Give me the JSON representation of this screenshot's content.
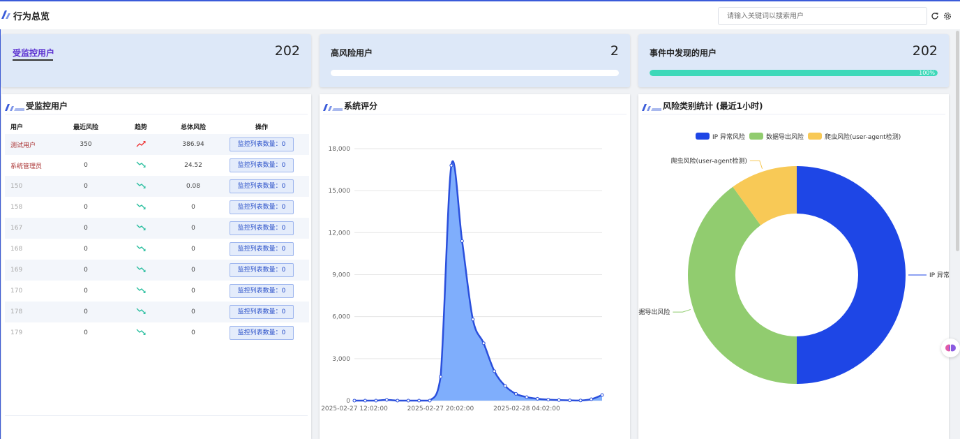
{
  "header": {
    "title": "行为总览",
    "search_placeholder": "请输入关键词以搜索用户",
    "refresh_icon": "refresh-icon",
    "settings_icon": "gear-icon"
  },
  "cards": [
    {
      "label": "受监控用户",
      "value": "202"
    },
    {
      "label": "高风险用户",
      "value": "2",
      "progress": 0
    },
    {
      "label": "事件中发现的用户",
      "value": "202",
      "progress": 100,
      "progress_text": "100%"
    }
  ],
  "users_panel": {
    "title": "受监控用户",
    "columns": [
      "用户",
      "最近风险",
      "趋势",
      "总体风险",
      "操作"
    ],
    "rows": [
      {
        "user": "测试用户",
        "recent": "350",
        "trend": "up",
        "total": "386.94",
        "action": "监控列表数量：0"
      },
      {
        "user": "系统管理员",
        "recent": "0",
        "trend": "down",
        "total": "24.52",
        "action": "监控列表数量：0"
      },
      {
        "user": "150",
        "recent": "0",
        "trend": "down",
        "total": "0.08",
        "action": "监控列表数量：0"
      },
      {
        "user": "158",
        "recent": "0",
        "trend": "down",
        "total": "0",
        "action": "监控列表数量：0"
      },
      {
        "user": "167",
        "recent": "0",
        "trend": "down",
        "total": "0",
        "action": "监控列表数量：0"
      },
      {
        "user": "168",
        "recent": "0",
        "trend": "down",
        "total": "0",
        "action": "监控列表数量：0"
      },
      {
        "user": "169",
        "recent": "0",
        "trend": "down",
        "total": "0",
        "action": "监控列表数量：0"
      },
      {
        "user": "170",
        "recent": "0",
        "trend": "down",
        "total": "0",
        "action": "监控列表数量：0"
      },
      {
        "user": "178",
        "recent": "0",
        "trend": "down",
        "total": "0",
        "action": "监控列表数量：0"
      },
      {
        "user": "179",
        "recent": "0",
        "trend": "down",
        "total": "0",
        "action": "监控列表数量：0"
      }
    ]
  },
  "score_panel": {
    "title": "系统评分"
  },
  "risk_panel": {
    "title": "风险类别统计 (最近1小时)"
  },
  "colors": {
    "accent": "#3a5bd9",
    "line": "#2a4fdc",
    "area": "#7faefc",
    "progress": "#3dd8b9"
  },
  "chart_data": [
    {
      "type": "area",
      "title": "",
      "xlabel": "",
      "ylabel": "",
      "ylim": [
        0,
        18000
      ],
      "yticks": [
        "0",
        "3,000",
        "6,000",
        "9,000",
        "12,000",
        "15,000",
        "18,000"
      ],
      "xticks": [
        "2025-02-27 12:02:00",
        "2025-02-27 20:02:00",
        "2025-02-28 04:02:00"
      ],
      "x": [
        "2025-02-27 12:02:00",
        "2025-02-27 13:02:00",
        "2025-02-27 14:02:00",
        "2025-02-27 15:02:00",
        "2025-02-27 16:02:00",
        "2025-02-27 17:02:00",
        "2025-02-27 18:02:00",
        "2025-02-27 19:02:00",
        "2025-02-27 20:02:00",
        "2025-02-27 21:02:00",
        "2025-02-27 22:02:00",
        "2025-02-27 23:02:00",
        "2025-02-28 00:02:00",
        "2025-02-28 01:02:00",
        "2025-02-28 02:02:00",
        "2025-02-28 03:02:00",
        "2025-02-28 04:02:00",
        "2025-02-28 05:02:00",
        "2025-02-28 06:02:00",
        "2025-02-28 07:02:00",
        "2025-02-28 08:02:00",
        "2025-02-28 09:02:00",
        "2025-02-28 10:02:00",
        "2025-02-28 11:02:00"
      ],
      "values": [
        0,
        0,
        0,
        50,
        0,
        0,
        0,
        0,
        1700,
        16800,
        11400,
        5800,
        4100,
        2100,
        1050,
        480,
        250,
        130,
        70,
        40,
        20,
        10,
        100,
        400
      ],
      "grid": true
    },
    {
      "type": "pie",
      "title": "",
      "legend": "top",
      "labels": [
        "IP 异常风险",
        "数据导出风险",
        "爬虫风险(user-agent检测)"
      ],
      "values": [
        50,
        40,
        10
      ],
      "colors": [
        "#1e46e6",
        "#91cc6f",
        "#f8c956"
      ]
    }
  ]
}
